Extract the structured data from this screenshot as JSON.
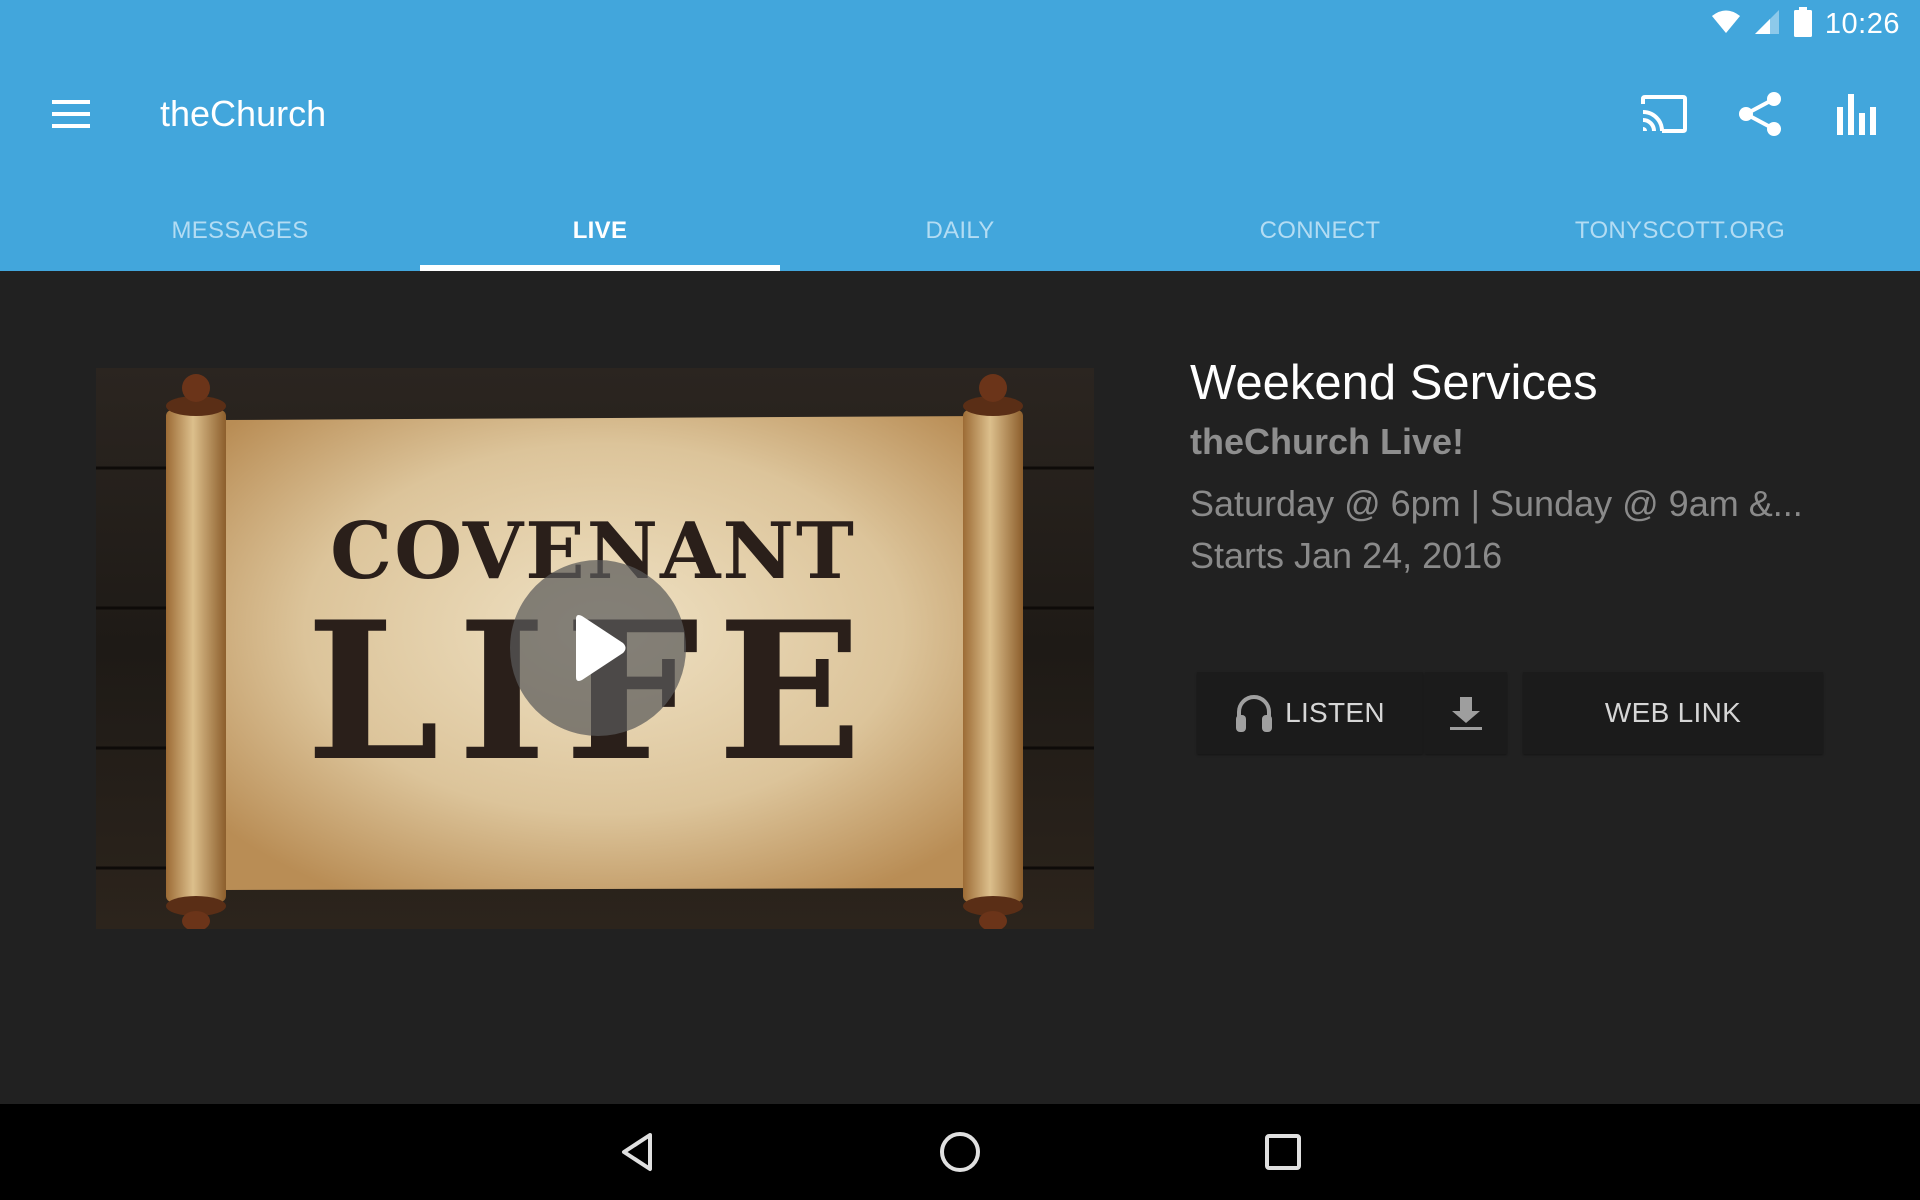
{
  "status_bar": {
    "time": "10:26",
    "icons": [
      "wifi-icon",
      "cellular-signal-icon",
      "battery-icon"
    ]
  },
  "toolbar": {
    "title": "theChurch",
    "menu_icon": "hamburger-menu-icon",
    "actions": [
      {
        "name": "cast",
        "icon": "cast-icon"
      },
      {
        "name": "share",
        "icon": "share-icon"
      },
      {
        "name": "stats",
        "icon": "bar-chart-icon"
      }
    ]
  },
  "tabs": [
    {
      "label": "MESSAGES",
      "active": false
    },
    {
      "label": "LIVE",
      "active": true
    },
    {
      "label": "DAILY",
      "active": false
    },
    {
      "label": "CONNECT",
      "active": false
    },
    {
      "label": "TONYSCOTT.ORG",
      "active": false
    }
  ],
  "live": {
    "thumbnail": {
      "line1": "COVENANT",
      "line2": "LIFE",
      "play_icon": "play-icon"
    },
    "title": "Weekend Services",
    "subtitle": "theChurch Live!",
    "schedule": "Saturday @ 6pm | Sunday @ 9am &...",
    "starts": "Starts Jan 24, 2016",
    "buttons": {
      "listen": "LISTEN",
      "download_icon": "download-icon",
      "weblink": "WEB LINK"
    }
  },
  "nav_bar": {
    "buttons": [
      "back",
      "home",
      "recents"
    ]
  },
  "colors": {
    "appbar": "#42a6dc",
    "background": "#212121",
    "tab_inactive": "#b3dcf3",
    "tab_active": "#ffffff"
  }
}
